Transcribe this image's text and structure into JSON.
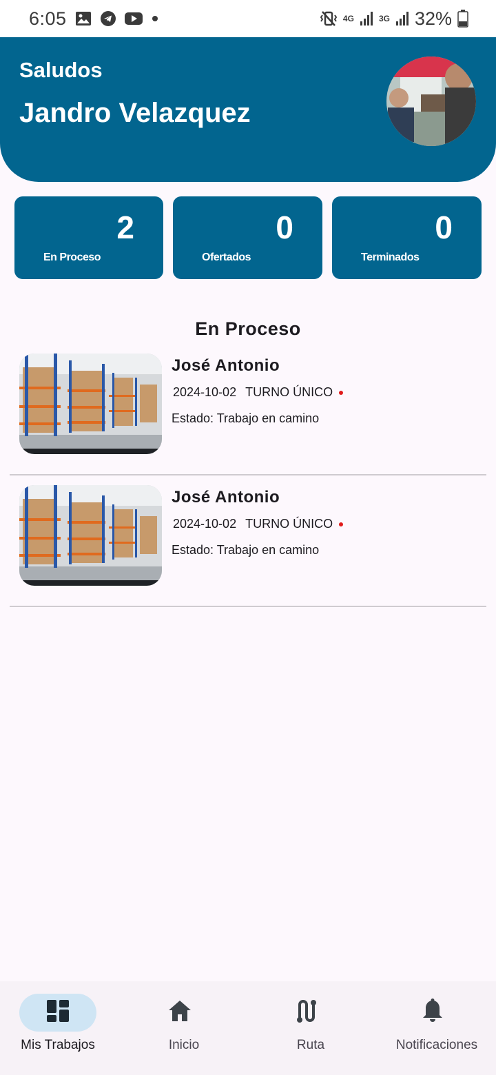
{
  "status_bar": {
    "time": "6:05",
    "network_labels": [
      "4G",
      "3G"
    ],
    "battery": "32%",
    "icons": [
      "gallery-icon",
      "telegram-icon",
      "youtube-icon",
      "notification-dot-icon",
      "vibrate-icon",
      "signal-icon",
      "battery-icon"
    ]
  },
  "header": {
    "greeting": "Saludos",
    "user_name": "Jandro Velazquez",
    "background": "#02658f"
  },
  "stats": [
    {
      "value": "2",
      "label": "En Proceso"
    },
    {
      "value": "0",
      "label": "Ofertados"
    },
    {
      "value": "0",
      "label": "Terminados"
    }
  ],
  "section": {
    "title": "En Proceso"
  },
  "jobs": [
    {
      "name": "José Antonio",
      "date": "2024-10-02",
      "shift": "TURNO ÚNICO",
      "status": "Estado: Trabajo en camino"
    },
    {
      "name": "José Antonio",
      "date": "2024-10-02",
      "shift": "TURNO ÚNICO",
      "status": "Estado: Trabajo en camino"
    }
  ],
  "bottom_nav": [
    {
      "label": "Mis Trabajos",
      "icon": "dashboard-icon",
      "active": true
    },
    {
      "label": "Inicio",
      "icon": "home-icon",
      "active": false
    },
    {
      "label": "Ruta",
      "icon": "route-icon",
      "active": false
    },
    {
      "label": "Notificaciones",
      "icon": "bell-icon",
      "active": false
    }
  ],
  "colors": {
    "primary": "#02658f",
    "nav_active": "#cfe5f4",
    "status_dot": "#e01b1b",
    "background": "#fdf8fd"
  }
}
